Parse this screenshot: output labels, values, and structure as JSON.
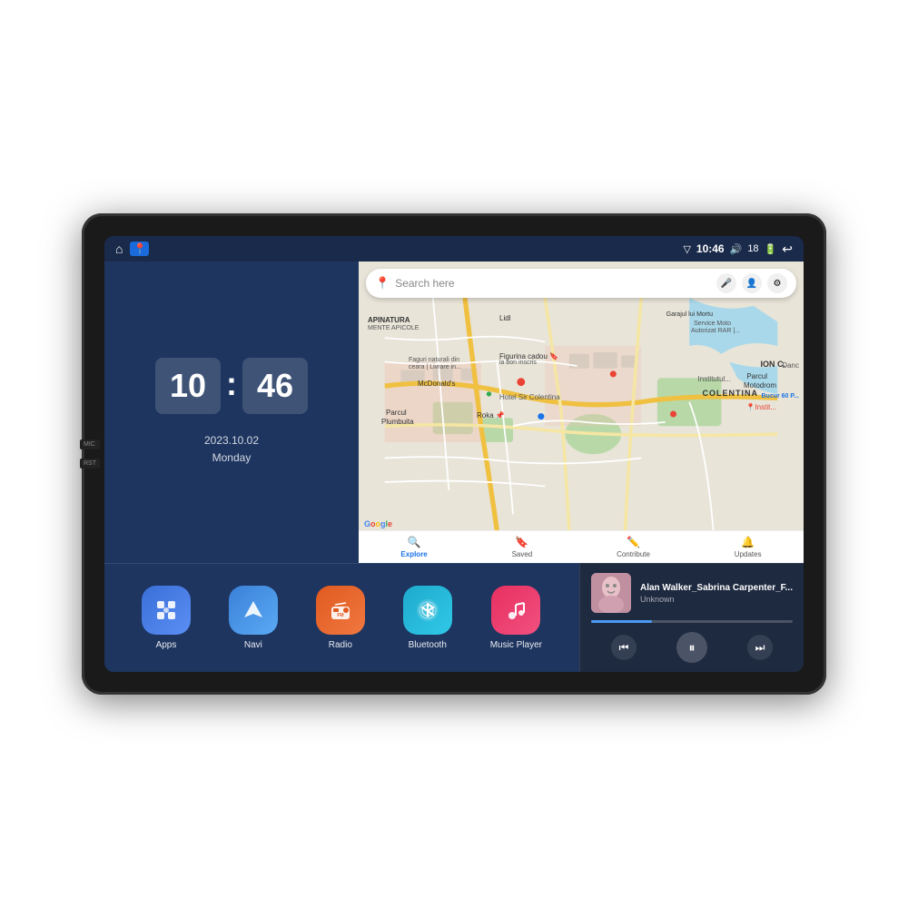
{
  "device": {
    "outer_bg": "#1a1a1a",
    "screen_bg": "#1a2a4a"
  },
  "status_bar": {
    "time": "10:46",
    "battery": "18",
    "icons": [
      "home",
      "map-pin"
    ]
  },
  "clock": {
    "hours": "10",
    "minutes": "46"
  },
  "date": {
    "line1": "2023.10.02",
    "line2": "Monday"
  },
  "map": {
    "search_placeholder": "Search here",
    "bottom_items": [
      {
        "label": "Explore",
        "active": true
      },
      {
        "label": "Saved",
        "active": false
      },
      {
        "label": "Contribute",
        "active": false
      },
      {
        "label": "Updates",
        "active": false
      }
    ],
    "labels": [
      "APINATURA",
      "MENTE APICOLE",
      "Lidl",
      "Garajul lui Mortu",
      "Service Moto",
      "Autorizat RAR",
      "Parcul Motodrom",
      "COLENTINA",
      "McDonald's",
      "Hotel Sir Colentina",
      "Roka",
      "Parcul Plumbuita",
      "ION C.",
      "Danc"
    ]
  },
  "apps": [
    {
      "id": "apps",
      "label": "Apps",
      "icon": "⊞"
    },
    {
      "id": "navi",
      "label": "Navi",
      "icon": "▲"
    },
    {
      "id": "radio",
      "label": "Radio",
      "icon": "📻"
    },
    {
      "id": "bluetooth",
      "label": "Bluetooth",
      "icon": "⚡"
    },
    {
      "id": "music",
      "label": "Music Player",
      "icon": "♪"
    }
  ],
  "music_player": {
    "title": "Alan Walker_Sabrina Carpenter_F...",
    "artist": "Unknown",
    "controls": {
      "prev": "⏮",
      "play": "⏸",
      "next": "⏭"
    }
  }
}
